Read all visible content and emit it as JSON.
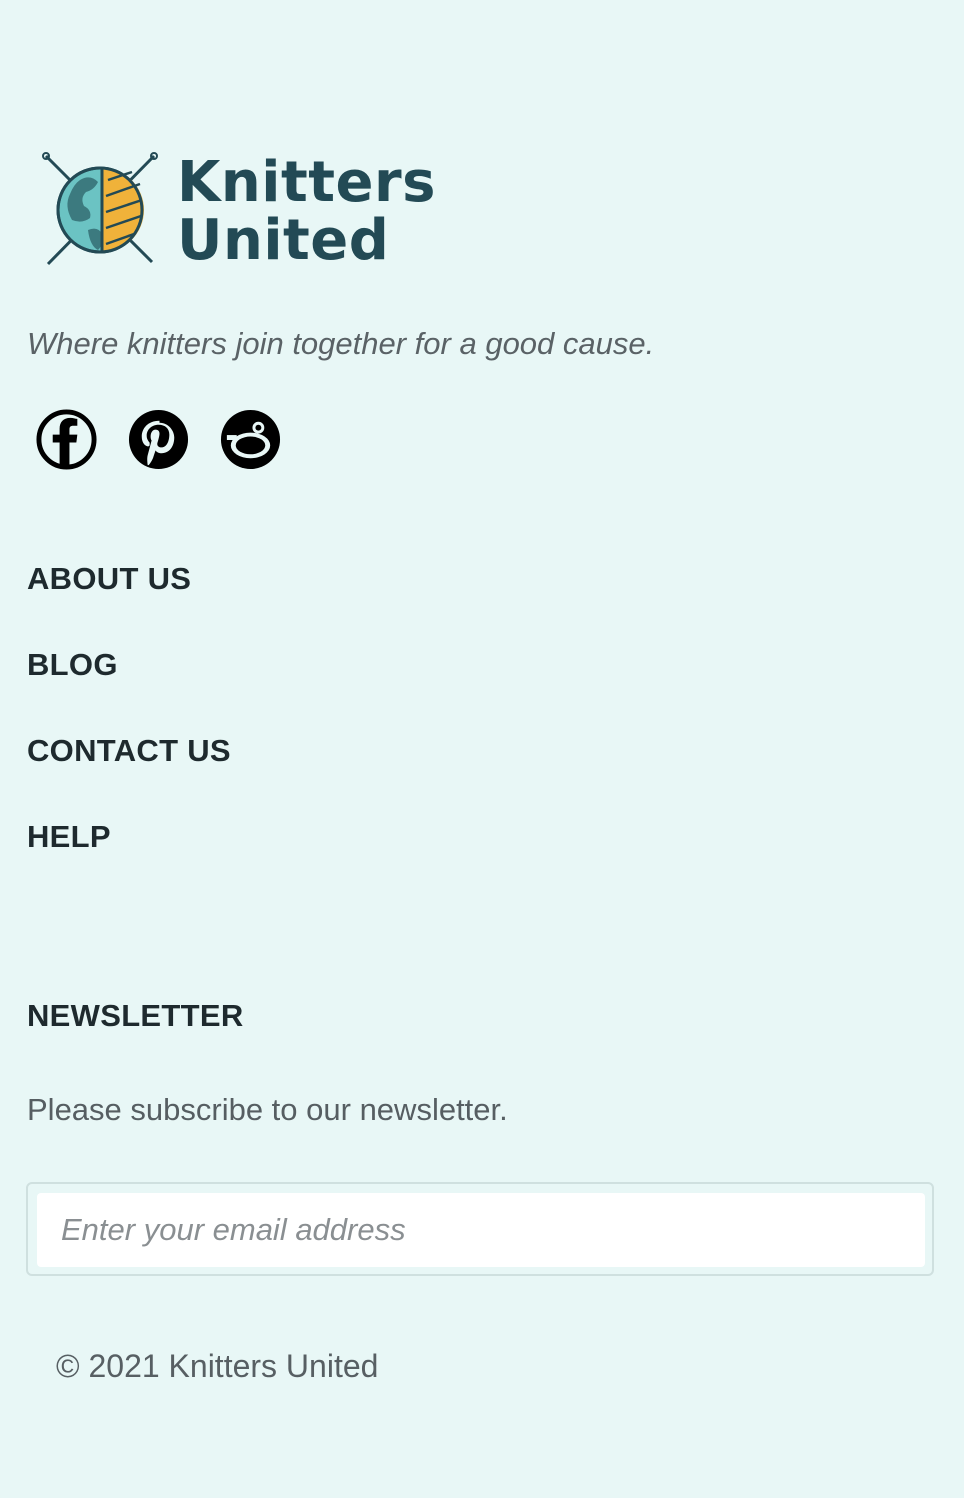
{
  "brand": {
    "line1": "Knitters",
    "line2": "United",
    "tagline": "Where knitters join together for a good cause.",
    "colors": {
      "text": "#234a55",
      "globe": "#6bc3c3",
      "land": "#3c7a7f",
      "yarn": "#f0b23a",
      "outline": "#234a55"
    }
  },
  "socials": [
    {
      "name": "facebook",
      "icon": "facebook-icon"
    },
    {
      "name": "pinterest",
      "icon": "pinterest-icon"
    },
    {
      "name": "reddit",
      "icon": "reddit-icon"
    }
  ],
  "nav": {
    "items": [
      "ABOUT US",
      "BLOG",
      "CONTACT US",
      "HELP"
    ]
  },
  "newsletter": {
    "title": "NEWSLETTER",
    "text": "Please subscribe to our newsletter.",
    "email_placeholder": "Enter your email address",
    "email_value": ""
  },
  "footer": {
    "copyright": "© 2021 Knitters United"
  },
  "theme": {
    "background": "#e8f7f6",
    "heading": "#1e2a2e",
    "muted": "#565e62"
  }
}
